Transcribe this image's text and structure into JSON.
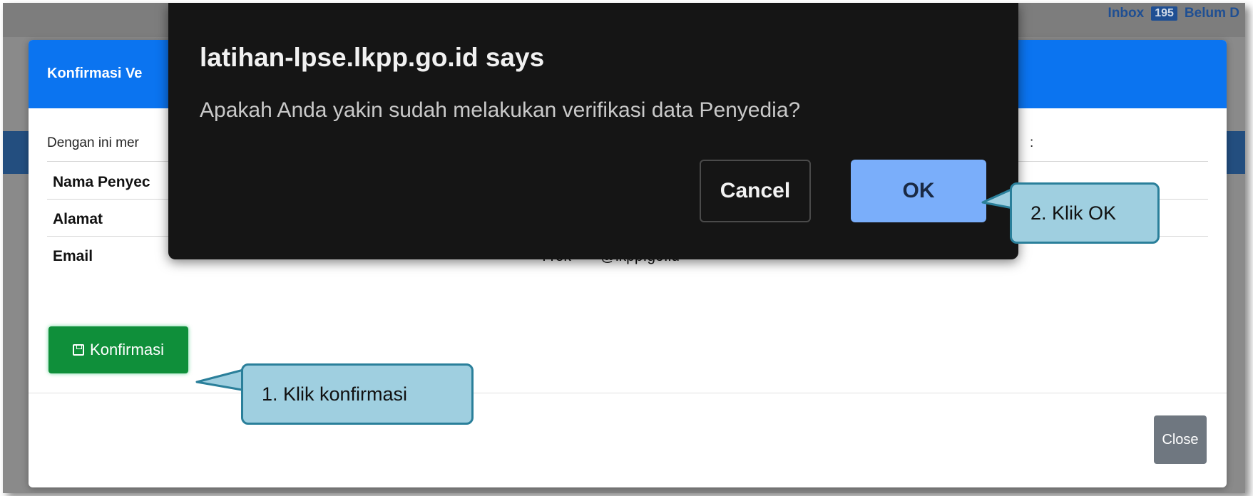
{
  "background": {
    "inbox_label": "Inbox",
    "inbox_count": "195",
    "unread_label": "Belum D"
  },
  "modal": {
    "title": "Konfirmasi Ve",
    "intro_text": "Dengan ini mer",
    "intro_tail": ":",
    "rows": [
      {
        "label": "Nama Penyec",
        "value": ""
      },
      {
        "label": "Alamat",
        "value": ""
      },
      {
        "label": "Email",
        "value": ": rek*****@lkpp.go.id"
      }
    ],
    "confirm_button": "Konfirmasi",
    "close_button": "Close"
  },
  "alert": {
    "title": "latihan-lpse.lkpp.go.id says",
    "message": "Apakah Anda yakin sudah melakukan verifikasi data Penyedia?",
    "cancel_label": "Cancel",
    "ok_label": "OK"
  },
  "callouts": {
    "step1": "1. Klik konfirmasi",
    "step2": "2. Klik OK"
  },
  "colors": {
    "modal_header": "#0b74f0",
    "confirm_button": "#0f8f3a",
    "ok_button": "#7aaefa",
    "callout_fill": "#9fcfe0",
    "callout_border": "#2a7f9a"
  }
}
